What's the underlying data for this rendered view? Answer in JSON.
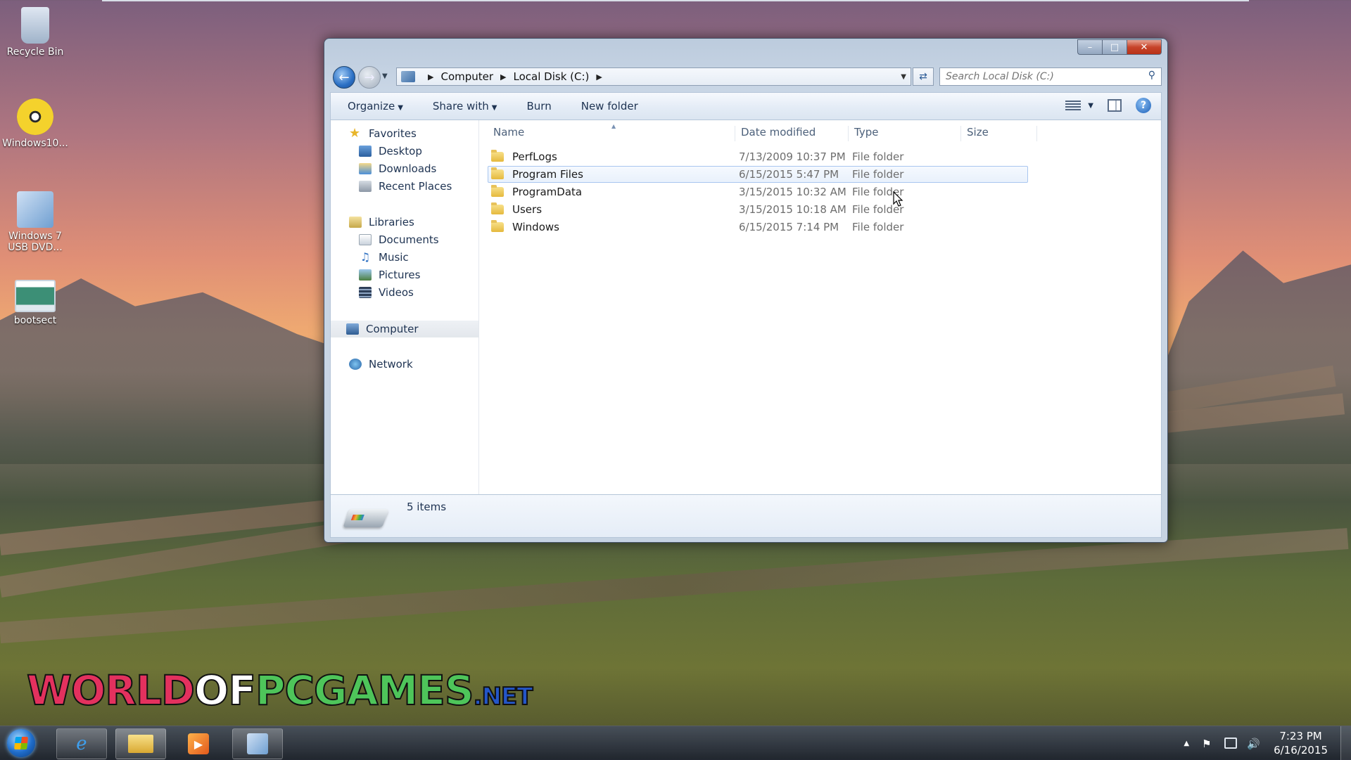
{
  "desktop": {
    "icons": [
      {
        "label": "Recycle Bin",
        "icon": "recycle-bin-icon"
      },
      {
        "label": "Windows10...",
        "icon": "dvd-disc-icon"
      },
      {
        "label": "Windows 7 USB DVD...",
        "icon": "usb-dvd-tool-icon"
      },
      {
        "label": "bootsect",
        "icon": "application-icon"
      }
    ]
  },
  "window": {
    "controls": {
      "minimize": "–",
      "maximize": "□",
      "close": "✕"
    },
    "breadcrumb": [
      "Computer",
      "Local Disk (C:)"
    ],
    "search": {
      "placeholder": "Search Local Disk (C:)"
    },
    "toolbar": {
      "organize": "Organize",
      "share_with": "Share with",
      "burn": "Burn",
      "new_folder": "New folder"
    },
    "nav": {
      "favorites": {
        "label": "Favorites",
        "items": [
          "Desktop",
          "Downloads",
          "Recent Places"
        ]
      },
      "libraries": {
        "label": "Libraries",
        "items": [
          "Documents",
          "Music",
          "Pictures",
          "Videos"
        ]
      },
      "computer": "Computer",
      "network": "Network"
    },
    "columns": {
      "name": "Name",
      "date": "Date modified",
      "type": "Type",
      "size": "Size"
    },
    "files": [
      {
        "name": "PerfLogs",
        "date": "7/13/2009 10:37 PM",
        "type": "File folder"
      },
      {
        "name": "Program Files",
        "date": "6/15/2015 5:47 PM",
        "type": "File folder"
      },
      {
        "name": "ProgramData",
        "date": "3/15/2015 10:32 AM",
        "type": "File folder"
      },
      {
        "name": "Users",
        "date": "3/15/2015 10:18 AM",
        "type": "File folder"
      },
      {
        "name": "Windows",
        "date": "6/15/2015 7:14 PM",
        "type": "File folder"
      }
    ],
    "status": {
      "item_count": "5 items"
    }
  },
  "watermark": {
    "world": "WORLD",
    "of": "OF",
    "pcgames": "PCGAMES",
    "net": ".NET"
  },
  "taskbar": {
    "apps": [
      "internet-explorer-icon",
      "file-explorer-icon",
      "media-player-icon",
      "usb-dvd-tool-icon"
    ],
    "clock": {
      "time": "7:23 PM",
      "date": "6/16/2015"
    }
  },
  "colors": {
    "accent": "#2a6fc4",
    "selection_border": "#a9c6ef"
  }
}
